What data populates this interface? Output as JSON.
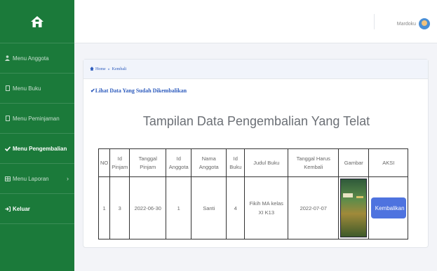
{
  "sidebar": {
    "items": [
      {
        "label": "Menu Anggota",
        "icon": "user-icon"
      },
      {
        "label": "Menu Buku",
        "icon": "book-icon"
      },
      {
        "label": "Menu Peminjaman",
        "icon": "book-icon"
      },
      {
        "label": "Menu Pengembalian",
        "icon": "check-icon"
      },
      {
        "label": "Menu Laporan",
        "icon": "table-icon"
      },
      {
        "label": "Keluar",
        "icon": "logout-icon"
      }
    ]
  },
  "topbar": {
    "username": "Mardoku"
  },
  "breadcrumb": {
    "home": "Home",
    "current": "Kembali"
  },
  "main": {
    "link_text": "Lihat Data Yang Sudah Dikembalikan",
    "title": "Tampilan Data Pengembalian Yang Telat"
  },
  "table": {
    "headers": [
      "NO",
      "Id Pinjam",
      "Tanggal Pinjam",
      "Id Anggota",
      "Nama Anggota",
      "Id Buku",
      "Judul Buku",
      "Tanggal Harus Kembali",
      "Gambar",
      "AKSI"
    ],
    "rows": [
      {
        "no": "1",
        "id_pinjam": "3",
        "tanggal_pinjam": "2022-06-30",
        "id_anggota": "1",
        "nama_anggota": "Santi",
        "id_buku": "4",
        "judul_buku": "Fikih MA kelas XI K13",
        "tanggal_kembali": "2022-07-07",
        "action": "Kembalikan"
      }
    ]
  },
  "colors": {
    "sidebar": "#1b7a3a",
    "accent": "#4e73df",
    "link": "#2d5bbd"
  }
}
